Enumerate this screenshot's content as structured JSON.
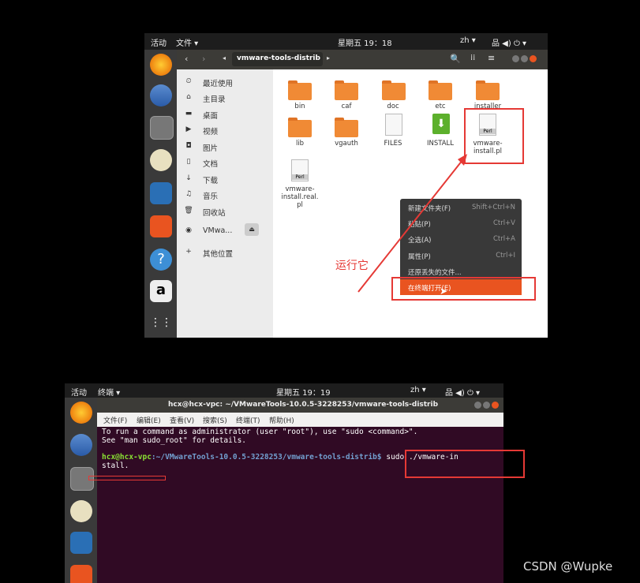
{
  "top": {
    "activities": "活动",
    "app_menu": "文件 ▾",
    "clock": "星期五 19：18",
    "lang": "zh ▾",
    "status_icons": "品 ◀) ⏻ ▾",
    "path": "vmware-tools-distrib",
    "sidebar": [
      "最近使用",
      "主目录",
      "桌面",
      "视频",
      "图片",
      "文档",
      "下载",
      "音乐",
      "回收站",
      "VMwa...",
      "其他位置"
    ],
    "files_row1": [
      "bin",
      "caf",
      "doc",
      "etc",
      "installer"
    ],
    "files_row2": [
      "lib",
      "vgauth",
      "FILES",
      "INSTALL",
      "vmware-\ninstall.pl"
    ],
    "files_row3": [
      "vmware-\ninstall.real.\npl"
    ],
    "menu": [
      {
        "label": "新建文件夹(F)",
        "shortcut": "Shift+Ctrl+N"
      },
      {
        "label": "粘贴(P)",
        "shortcut": "Ctrl+V"
      },
      {
        "label": "全选(A)",
        "shortcut": "Ctrl+A"
      },
      {
        "label": "属性(P)",
        "shortcut": "Ctrl+I"
      },
      {
        "label": "还原丢失的文件...",
        "shortcut": ""
      },
      {
        "label": "在终端打开(E)",
        "shortcut": ""
      }
    ],
    "annotation": "运行它",
    "perl_tag": "Perl"
  },
  "bottom": {
    "activities": "活动",
    "app_menu": "终端 ▾",
    "clock": "星期五 19：19",
    "lang": "zh ▾",
    "status_icons": "品 ◀) ⏻ ▾",
    "title": "hcx@hcx-vpc: ~/VMwareTools-10.0.5-3228253/vmware-tools-distrib",
    "menubar": [
      "文件(F)",
      "编辑(E)",
      "查看(V)",
      "搜索(S)",
      "终端(T)",
      "帮助(H)"
    ],
    "line1": "To run a command as administrator (user \"root\"), use \"sudo <command>\".",
    "line2": "See \"man sudo_root\" for details.",
    "prompt_user": "hcx@hcx-vpc",
    "prompt_path": ":~/VMwareTools-10.0.5-3228253/vmware-tools-distrib$",
    "command": " sudo ./vmware-in",
    "command_wrap": "stall."
  },
  "watermark": "CSDN @Wupke",
  "colors": {
    "accent": "#e95420",
    "annotation": "#e53935",
    "terminal_bg": "#300a24",
    "prompt_green": "#8ae234",
    "prompt_blue": "#729fcf"
  }
}
